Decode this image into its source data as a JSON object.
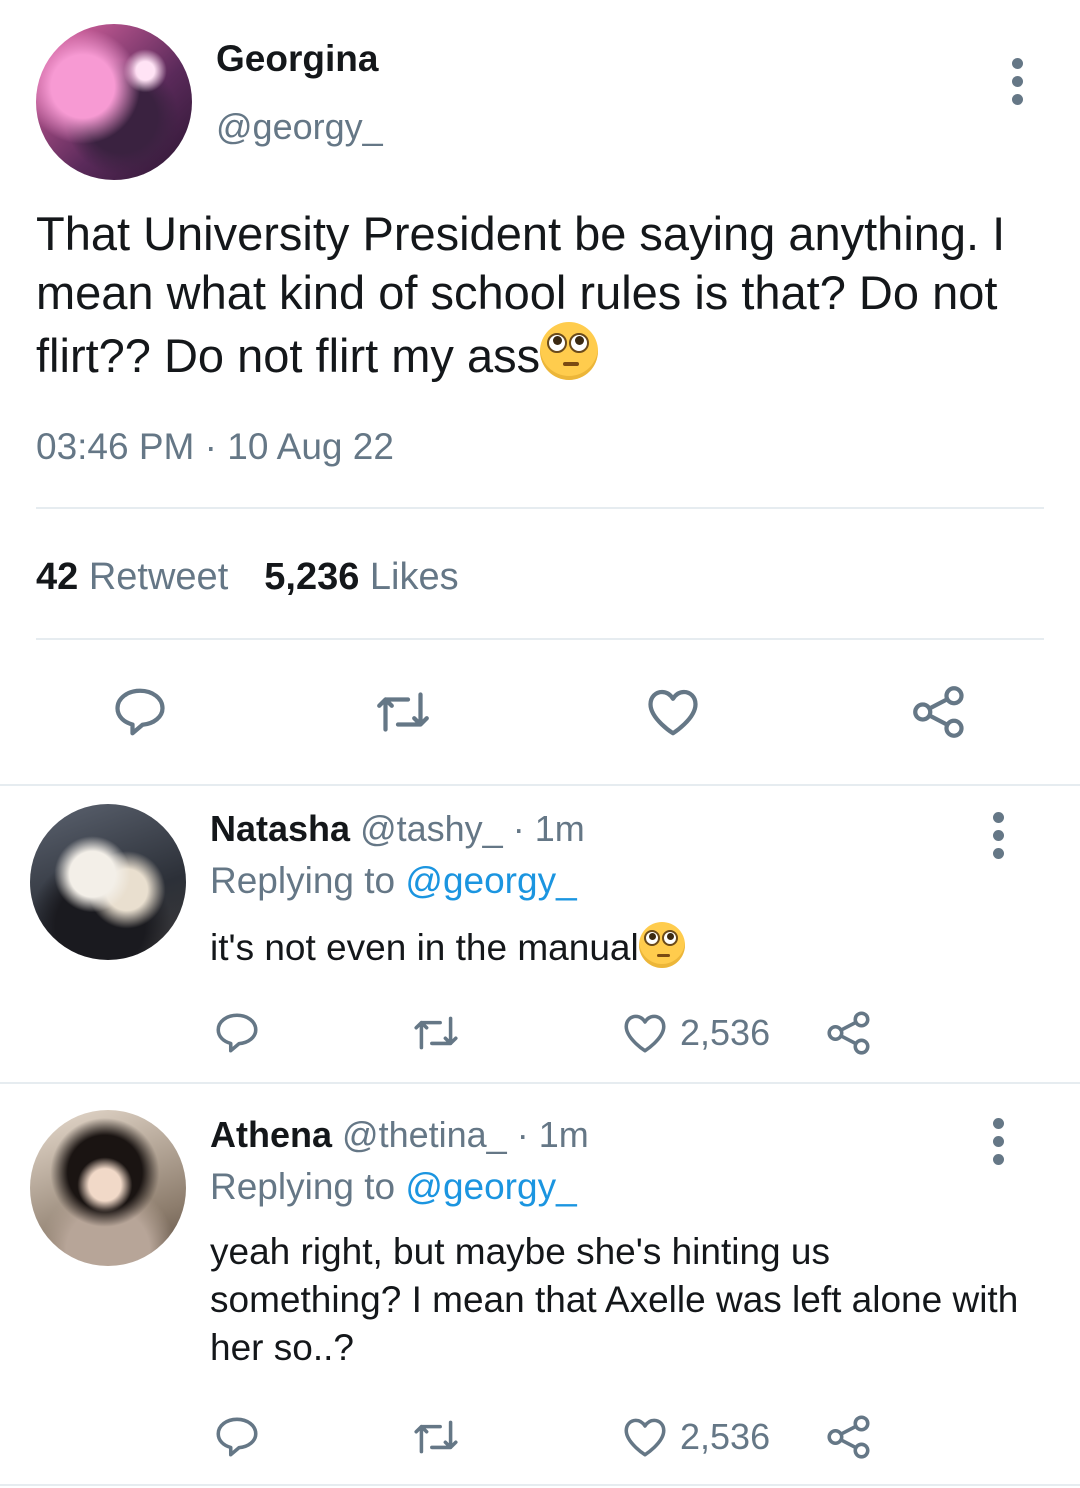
{
  "main_tweet": {
    "name": "Georgina",
    "handle": "@georgy_",
    "text": "That University President be saying anything. I mean what kind of school rules is that? Do not flirt?? Do not flirt my ass",
    "emoji": "face-with-rolling-eyes",
    "timestamp": "03:46 PM · 10 Aug 22",
    "retweet_count": "42",
    "retweet_label": "Retweet",
    "likes_count": "5,236",
    "likes_label": "Likes"
  },
  "replies": [
    {
      "name": "Natasha",
      "handle": "@tashy_",
      "time": "· 1m",
      "replying_prefix": "Replying to",
      "replying_to": "@georgy_",
      "text": "it's not even in the manual",
      "emoji": "face-with-rolling-eyes",
      "like_count": "2,536"
    },
    {
      "name": "Athena",
      "handle": "@thetina_",
      "time": "· 1m",
      "replying_prefix": "Replying to",
      "replying_to": "@georgy_",
      "text": "yeah right, but maybe she's hinting us something? I mean that Axelle was left alone with her so..?",
      "emoji": null,
      "like_count": "2,536"
    }
  ],
  "icons": [
    "reply-icon",
    "retweet-icon",
    "like-icon",
    "share-icon",
    "more-icon"
  ],
  "colors": {
    "text": "#14171a",
    "secondary": "#657786",
    "link": "#1b95e0",
    "divider": "#e6ecf0"
  }
}
